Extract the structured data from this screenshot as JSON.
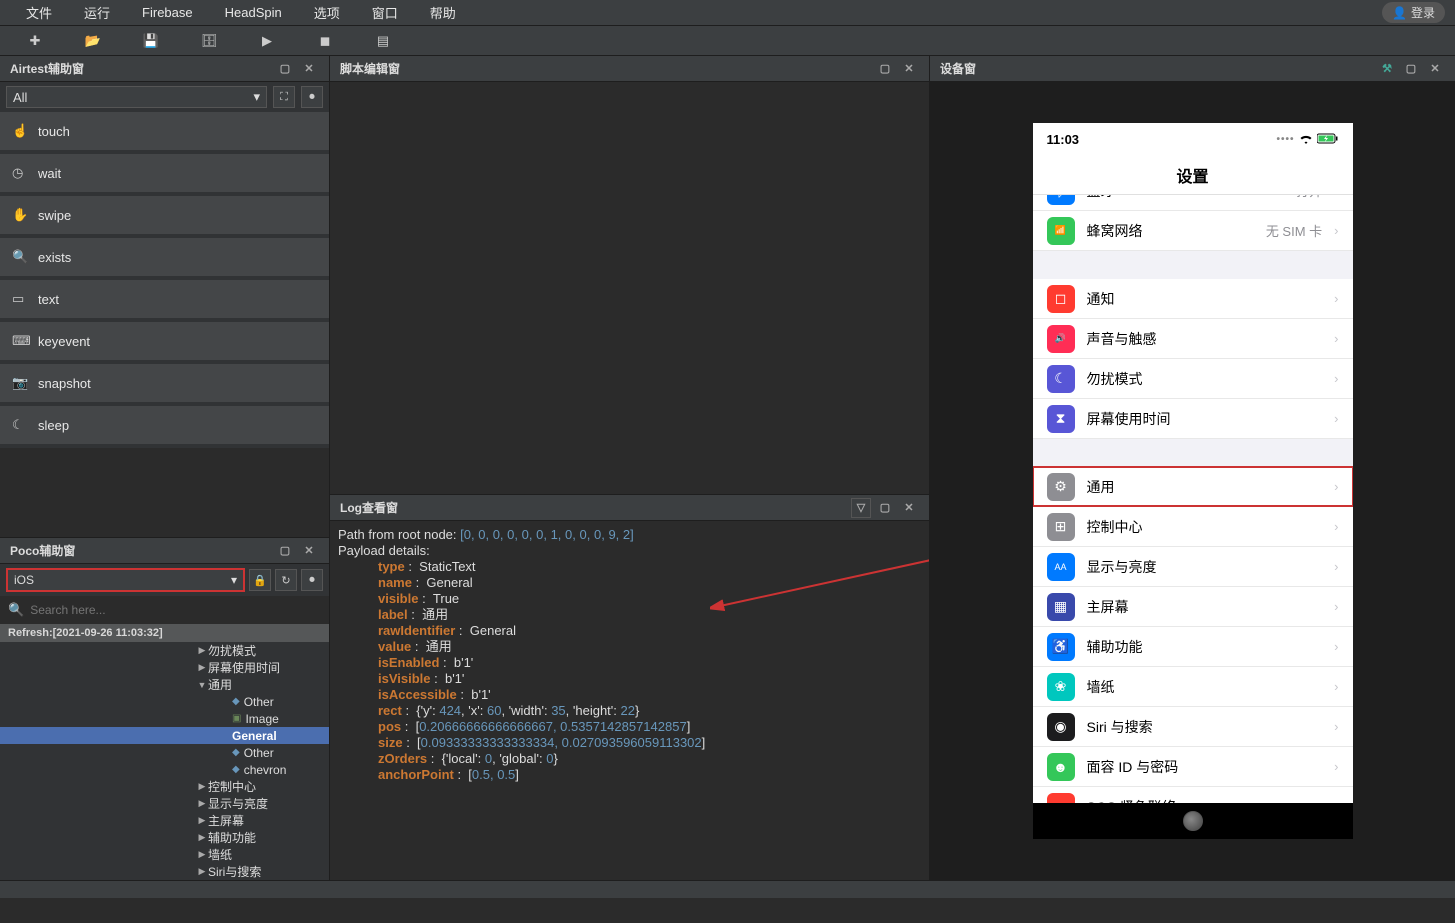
{
  "menu": {
    "file": "文件",
    "run": "运行",
    "firebase": "Firebase",
    "headspin": "HeadSpin",
    "options": "选项",
    "window": "窗口",
    "help": "帮助",
    "login": "登录"
  },
  "panels": {
    "airtest": "Airtest辅助窗",
    "script": "脚本编辑窗",
    "log": "Log查看窗",
    "poco": "Poco辅助窗",
    "device": "设备窗"
  },
  "airtest": {
    "filter": "All",
    "ops": [
      "touch",
      "wait",
      "swipe",
      "exists",
      "text",
      "keyevent",
      "snapshot",
      "sleep"
    ]
  },
  "poco": {
    "selector": "iOS",
    "search_placeholder": "Search here...",
    "refresh": "Refresh:[2021-09-26 11:03:32]",
    "tree": [
      {
        "label": "勿扰模式",
        "depth": 196,
        "arrow": "▶"
      },
      {
        "label": "屏幕使用时间",
        "depth": 196,
        "arrow": "▶"
      },
      {
        "label": "通用",
        "depth": 196,
        "arrow": "▼"
      },
      {
        "label": "Other",
        "depth": 232,
        "bullet": true
      },
      {
        "label": "Image",
        "depth": 232,
        "img": true
      },
      {
        "label": "General",
        "depth": 232,
        "bold": true,
        "selected": true
      },
      {
        "label": "Other",
        "depth": 232,
        "bullet": true
      },
      {
        "label": "chevron",
        "depth": 232,
        "bullet": true
      },
      {
        "label": "控制中心",
        "depth": 196,
        "arrow": "▶"
      },
      {
        "label": "显示与亮度",
        "depth": 196,
        "arrow": "▶"
      },
      {
        "label": "主屏幕",
        "depth": 196,
        "arrow": "▶"
      },
      {
        "label": "辅助功能",
        "depth": 196,
        "arrow": "▶"
      },
      {
        "label": "墙纸",
        "depth": 196,
        "arrow": "▶"
      },
      {
        "label": "Siri与搜索",
        "depth": 196,
        "arrow": "▶"
      }
    ]
  },
  "log": {
    "path_prefix": "Path from root node: ",
    "path_values": "[0, 0, 0, 0, 0, 0, 1, 0, 0, 0, 9, 2]",
    "payload": "Payload details:",
    "lines": [
      {
        "k": "type",
        "v": "StaticText"
      },
      {
        "k": "name",
        "v": "General"
      },
      {
        "k": "visible",
        "v": "True"
      },
      {
        "k": "label",
        "v": "通用"
      },
      {
        "k": "rawIdentifier",
        "v": "General"
      },
      {
        "k": "value",
        "v": "通用"
      },
      {
        "k": "isEnabled",
        "v": "b'1'"
      },
      {
        "k": "isVisible",
        "v": "b'1'"
      },
      {
        "k": "isAccessible",
        "v": "b'1'"
      }
    ],
    "rect": "{'y': 424, 'x': 60, 'width': 35, 'height': 22}",
    "pos": "[0.20666666666666667, 0.5357142857142857]",
    "size": "[0.09333333333333334, 0.027093596059113302]",
    "zorders": "{'local': 0, 'global': 0}",
    "anchor": "[0.5, 0.5]"
  },
  "phone": {
    "time": "11:03",
    "title": "设置",
    "partial_top": {
      "label": "蓝牙",
      "val": "打开"
    },
    "rows": [
      {
        "label": "蜂窝网络",
        "val": "无 SIM 卡",
        "color": "#34c759",
        "icon": "📶",
        "gap_after": true
      },
      {
        "label": "通知",
        "color": "#ff3b30",
        "icon": "◻"
      },
      {
        "label": "声音与触感",
        "color": "#ff2d55",
        "icon": "🔊"
      },
      {
        "label": "勿扰模式",
        "color": "#5856d6",
        "icon": "☾"
      },
      {
        "label": "屏幕使用时间",
        "color": "#5856d6",
        "icon": "⧗",
        "gap_after": true
      },
      {
        "label": "通用",
        "color": "#8e8e93",
        "icon": "⚙",
        "highlight": true
      },
      {
        "label": "控制中心",
        "color": "#8e8e93",
        "icon": "⊞"
      },
      {
        "label": "显示与亮度",
        "color": "#007aff",
        "icon": "AA"
      },
      {
        "label": "主屏幕",
        "color": "#3949ab",
        "icon": "▦"
      },
      {
        "label": "辅助功能",
        "color": "#007aff",
        "icon": "♿"
      },
      {
        "label": "墙纸",
        "color": "#00c7be",
        "icon": "❀"
      },
      {
        "label": "Siri 与搜索",
        "color": "#1c1c1e",
        "icon": "◉"
      },
      {
        "label": "面容 ID 与密码",
        "color": "#34c759",
        "icon": "☻"
      },
      {
        "label": "SOS 紧急联络",
        "color": "#ff3b30",
        "icon": "SOS"
      }
    ]
  }
}
